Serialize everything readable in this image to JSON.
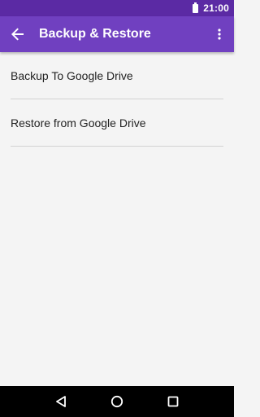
{
  "status_bar": {
    "time": "21:00",
    "battery_icon": "battery-full-icon"
  },
  "toolbar": {
    "title": "Backup & Restore",
    "back_icon": "arrow-back-icon",
    "overflow_icon": "more-vert-icon",
    "background_color": "#7040c0"
  },
  "list": {
    "items": [
      {
        "label": "Backup To Google Drive"
      },
      {
        "label": "Restore from Google Drive"
      }
    ]
  },
  "nav_bar": {
    "back_icon": "nav-back-icon",
    "home_icon": "nav-home-icon",
    "recents_icon": "nav-recents-icon"
  },
  "colors": {
    "status_bar": "#5b2aa4",
    "accent": "#7040c0",
    "background": "#f4f4f4"
  }
}
